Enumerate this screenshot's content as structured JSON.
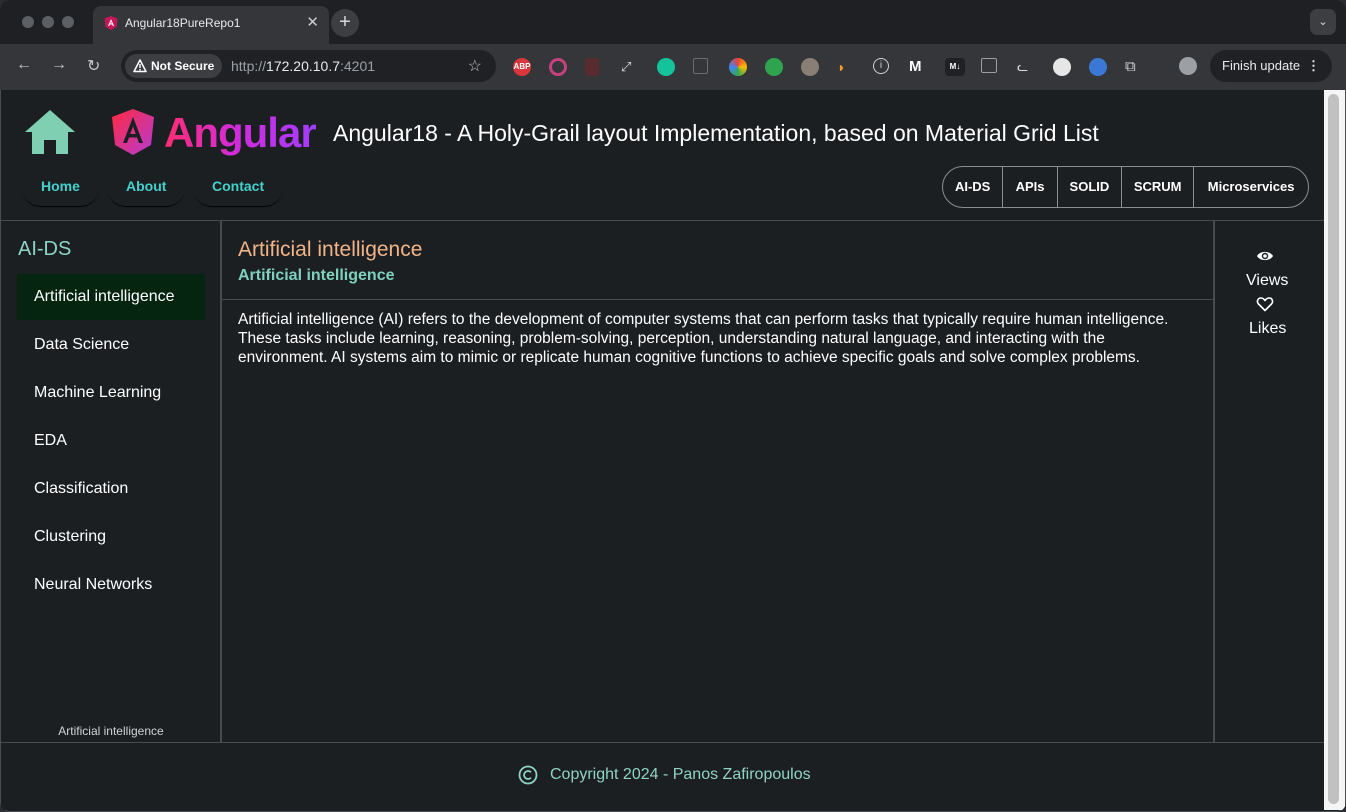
{
  "browser": {
    "tab_title": "Angular18PureRepo1",
    "security_label": "Not Secure",
    "url_scheme": "http://",
    "url_host": "172.20.10.7",
    "url_port": ":4201",
    "finish_update_label": "Finish update",
    "extensions": [
      "abp-icon",
      "ring-icon",
      "pdf-icon",
      "pin-icon",
      "grammarly-icon",
      "copy-icon",
      "color-wheel-icon",
      "github-icon",
      "glasses-icon",
      "ghost-icon",
      "info-icon",
      "m-logo-icon",
      "markdown-icon",
      "window-icon",
      "cat-icon",
      "moon-icon",
      "globe-icon",
      "puzzle-icon"
    ],
    "extension_abp_label": "ABP",
    "extension_md_label": "M↓"
  },
  "header": {
    "logo_word": "Angular",
    "app_title": "Angular18 - A Holy-Grail layout Implementation, based on Material Grid List",
    "nav_links": [
      "Home",
      "About",
      "Contact"
    ],
    "topic_buttons": [
      "AI-DS",
      "APIs",
      "SOLID",
      "SCRUM",
      "Microservices"
    ]
  },
  "sidebar": {
    "title": "AI-DS",
    "items": [
      "Artificial intelligence",
      "Data Science",
      "Machine Learning",
      "EDA",
      "Classification",
      "Clustering",
      "Neural Networks"
    ],
    "active_index": 0,
    "footer": "Artificial intelligence"
  },
  "main": {
    "title": "Artificial intelligence",
    "subtitle": "Artificial intelligence",
    "body": "Artificial intelligence (AI) refers to the development of computer systems that can perform tasks that typically require human intelligence. These tasks include learning, reasoning, problem-solving, perception, understanding natural language, and interacting with the environment. AI systems aim to mimic or replicate human cognitive functions to achieve specific goals and solve complex problems."
  },
  "right_panel": {
    "views_label": "Views",
    "likes_label": "Likes"
  },
  "footer": {
    "copyright": "Copyright 2024 - Panos Zafiropoulos"
  },
  "colors": {
    "accent_teal": "#45d0cc",
    "title_orange": "#f0b488",
    "subtitle_green": "#7fd0be",
    "active_item_bg": "#062510",
    "home_icon": "#7fcfb3"
  }
}
